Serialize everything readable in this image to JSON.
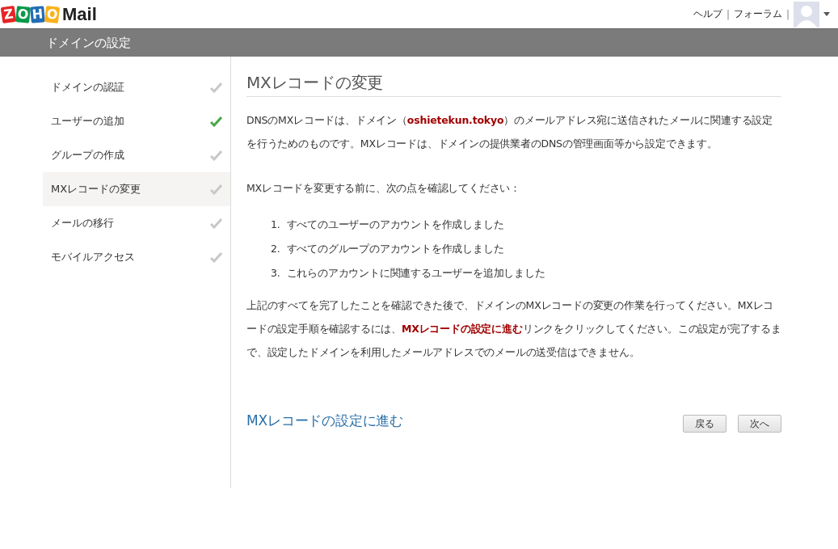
{
  "logo": {
    "letters": [
      {
        "char": "Z",
        "color": "#e42527"
      },
      {
        "char": "O",
        "color": "#089949"
      },
      {
        "char": "H",
        "color": "#226db4"
      },
      {
        "char": "O",
        "color": "#f9b21d"
      }
    ],
    "product": "Mail"
  },
  "top_links": [
    {
      "label": "ヘルプ",
      "separator": "|"
    },
    {
      "label": "フォーラム",
      "separator": "|"
    }
  ],
  "title_bar": "ドメインの設定",
  "steps": [
    {
      "label": "ドメインの認証",
      "done": false,
      "selected": false
    },
    {
      "label": "ユーザーの追加",
      "done": true,
      "selected": false
    },
    {
      "label": "グループの作成",
      "done": false,
      "selected": false
    },
    {
      "label": "MXレコードの変更",
      "done": false,
      "selected": true
    },
    {
      "label": "メールの移行",
      "done": false,
      "selected": false
    },
    {
      "label": "モバイルアクセス",
      "done": false,
      "selected": false
    }
  ],
  "heading": "MXレコードの変更",
  "intro": "DNSのMXレコードは、ドメイン（**oshietekun.tokyo**）のメールアドレス宛に送信されたメールに関連する設定を行うためのものです。MXレコードは、ドメインの提供業者のDNSの管理画面等から設定できます。",
  "checklist_lead": "MXレコードを変更する前に、次の点を確認してください：",
  "checklist": [
    {
      "number": "1.",
      "text": "すべてのユーザーのアカウントを作成しました"
    },
    {
      "number": "2.",
      "text": "すべてのグループのアカウントを作成しました"
    },
    {
      "number": "3.",
      "text": "これらのアカウントに関連するユーザーを追加しました"
    }
  ],
  "note": "上記のすべてを完了したことを確認できた後で、ドメインのMXレコードの変更の作業を行ってください。MXレコードの設定手順を確認するには、**MXレコードの設定に進む**リンクをクリックしてください。この設定が完了するまで、設定したドメインを利用したメールアドレスでのメールの送受信はできません。",
  "link": "MXレコードの設定に進む",
  "buttons": [
    "戻る",
    "次へ"
  ]
}
